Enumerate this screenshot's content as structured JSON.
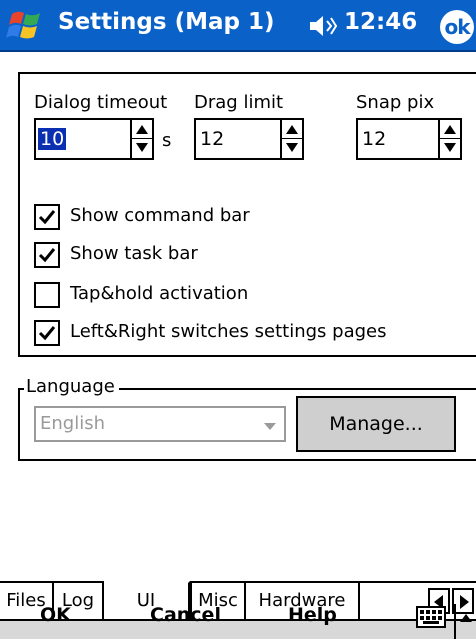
{
  "titlebar": {
    "title": "Settings (Map 1)",
    "time": "12:46",
    "ok_label": "ok",
    "start_icon": "windows-flag-icon",
    "volume_icon": "speaker-icon"
  },
  "settings": {
    "dialog_timeout": {
      "label": "Dialog timeout",
      "value": "10",
      "unit": "s"
    },
    "drag_limit": {
      "label": "Drag limit",
      "value": "12"
    },
    "snap_pix": {
      "label": "Snap pix",
      "value": "12"
    }
  },
  "checkboxes": [
    {
      "label": "Show command bar",
      "checked": true
    },
    {
      "label": "Show task bar",
      "checked": true
    },
    {
      "label": "Tap&hold activation",
      "checked": false
    },
    {
      "label": "Left&Right switches settings pages",
      "checked": true
    }
  ],
  "language": {
    "legend": "Language",
    "selected": "English",
    "manage_label": "Manage..."
  },
  "tabs": [
    {
      "label": "Files",
      "active": false
    },
    {
      "label": "Log",
      "active": false
    },
    {
      "label": "UI",
      "active": true
    },
    {
      "label": "Misc",
      "active": false
    },
    {
      "label": "Hardware",
      "active": false
    }
  ],
  "menubar": {
    "ok": "OK",
    "cancel": "Cancel",
    "help": "Help",
    "keyboard_icon": "keyboard-icon"
  },
  "colors": {
    "titlebar": "#0a62c9",
    "selection": "#0a2fb0",
    "disabled_text": "#9a9a9a",
    "button_face": "#cfcfcf"
  }
}
